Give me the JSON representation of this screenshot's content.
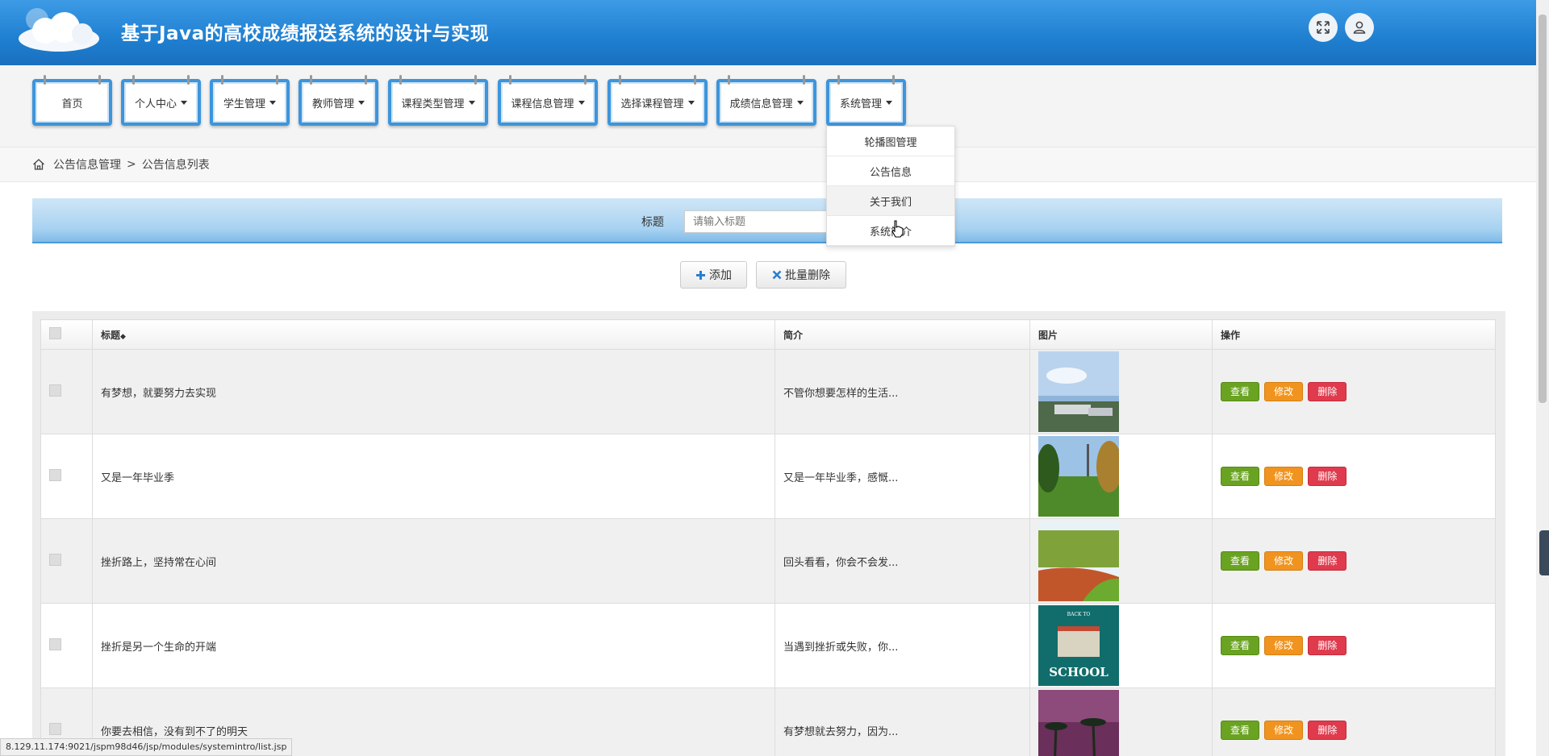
{
  "header": {
    "title": "基于Java的高校成绩报送系统的设计与实现"
  },
  "nav": {
    "items": [
      {
        "label": "首页"
      },
      {
        "label": "个人中心"
      },
      {
        "label": "学生管理"
      },
      {
        "label": "教师管理"
      },
      {
        "label": "课程类型管理"
      },
      {
        "label": "课程信息管理"
      },
      {
        "label": "选择课程管理"
      },
      {
        "label": "成绩信息管理"
      },
      {
        "label": "系统管理"
      }
    ]
  },
  "dropdown": {
    "items": [
      {
        "label": "轮播图管理"
      },
      {
        "label": "公告信息"
      },
      {
        "label": "关于我们"
      },
      {
        "label": "系统简介"
      }
    ]
  },
  "breadcrumb": {
    "parent": "公告信息管理",
    "separator": ">",
    "current": "公告信息列表"
  },
  "search": {
    "label": "标题",
    "placeholder": "请输入标题"
  },
  "actions": {
    "add": "添加",
    "batch_delete": "批量删除"
  },
  "table": {
    "headers": {
      "title": "标题",
      "intro": "简介",
      "image": "图片",
      "ops": "操作"
    },
    "ops": {
      "view": "查看",
      "edit": "修改",
      "delete": "删除"
    },
    "rows": [
      {
        "title": "有梦想，就要努力去实现",
        "intro": "不管你想要怎样的生活..."
      },
      {
        "title": "又是一年毕业季",
        "intro": "又是一年毕业季，感慨..."
      },
      {
        "title": "挫折路上，坚持常在心间",
        "intro": "回头看看，你会不会发..."
      },
      {
        "title": "挫折是另一个生命的开端",
        "intro": "当遇到挫折或失败，你..."
      },
      {
        "title": "你要去相信，没有到不了的明天",
        "intro": "有梦想就去努力，因为..."
      }
    ],
    "thumb_text": {
      "back_to": "BACK TO",
      "school": "SCHOOL"
    }
  },
  "status_url": "8.129.11.174:9021/jspm98d46/jsp/modules/systemintro/list.jsp",
  "colors": {
    "header": "#1f7fd0",
    "nav_border": "#3d95dc",
    "view": "#6aa321",
    "edit": "#f0941f",
    "delete": "#e03a4d"
  }
}
